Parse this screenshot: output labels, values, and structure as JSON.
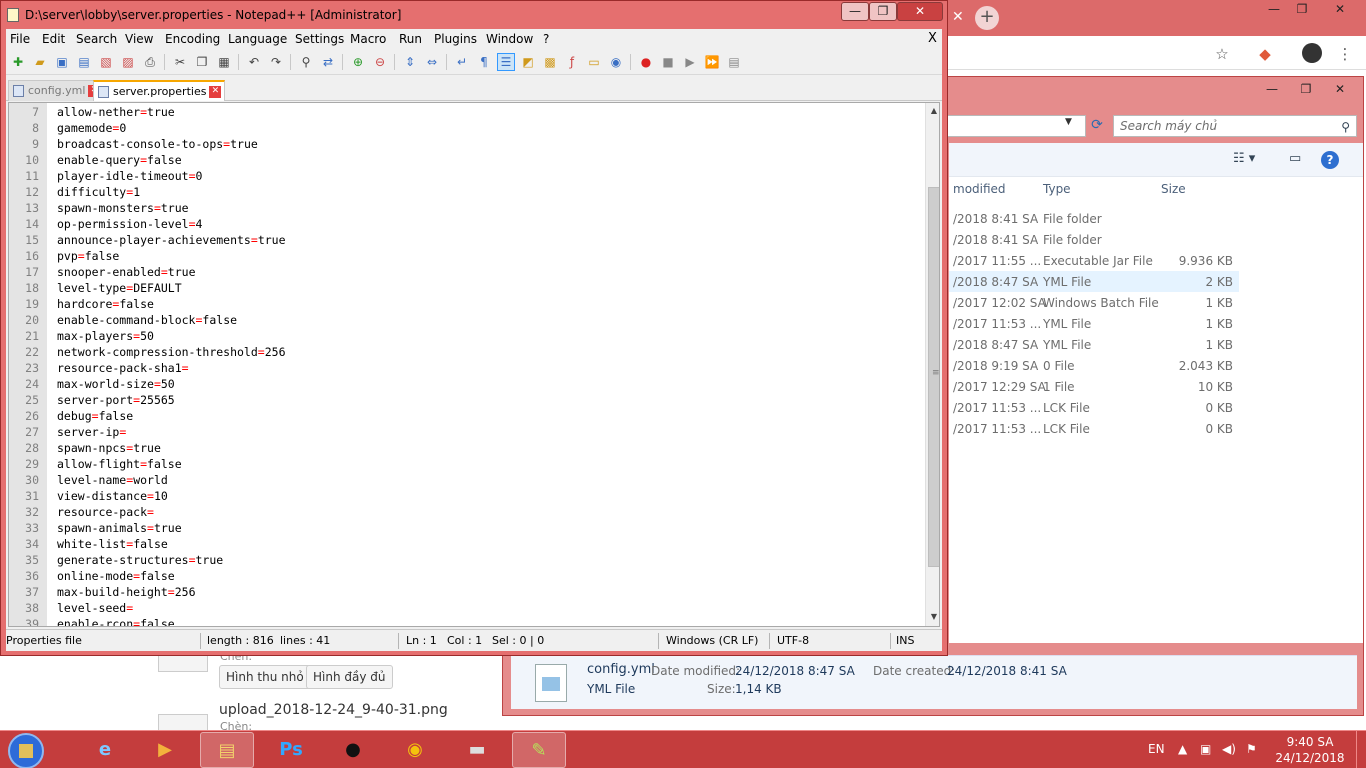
{
  "notepad": {
    "title": "D:\\server\\lobby\\server.properties - Notepad++ [Administrator]",
    "menu": [
      "File",
      "Edit",
      "Search",
      "View",
      "Encoding",
      "Language",
      "Settings",
      "Macro",
      "Run",
      "Plugins",
      "Window",
      "?"
    ],
    "menu_close": "X",
    "tabs": [
      {
        "label": "config.yml",
        "active": false
      },
      {
        "label": "server.properties",
        "active": true
      }
    ],
    "lines": [
      {
        "n": "7",
        "key": "allow-nether",
        "value": "true"
      },
      {
        "n": "8",
        "key": "gamemode",
        "value": "0"
      },
      {
        "n": "9",
        "key": "broadcast-console-to-ops",
        "value": "true"
      },
      {
        "n": "10",
        "key": "enable-query",
        "value": "false"
      },
      {
        "n": "11",
        "key": "player-idle-timeout",
        "value": "0"
      },
      {
        "n": "12",
        "key": "difficulty",
        "value": "1"
      },
      {
        "n": "13",
        "key": "spawn-monsters",
        "value": "true"
      },
      {
        "n": "14",
        "key": "op-permission-level",
        "value": "4"
      },
      {
        "n": "15",
        "key": "announce-player-achievements",
        "value": "true"
      },
      {
        "n": "16",
        "key": "pvp",
        "value": "false"
      },
      {
        "n": "17",
        "key": "snooper-enabled",
        "value": "true"
      },
      {
        "n": "18",
        "key": "level-type",
        "value": "DEFAULT"
      },
      {
        "n": "19",
        "key": "hardcore",
        "value": "false"
      },
      {
        "n": "20",
        "key": "enable-command-block",
        "value": "false"
      },
      {
        "n": "21",
        "key": "max-players",
        "value": "50"
      },
      {
        "n": "22",
        "key": "network-compression-threshold",
        "value": "256"
      },
      {
        "n": "23",
        "key": "resource-pack-sha1",
        "value": ""
      },
      {
        "n": "24",
        "key": "max-world-size",
        "value": "50"
      },
      {
        "n": "25",
        "key": "server-port",
        "value": "25565"
      },
      {
        "n": "26",
        "key": "debug",
        "value": "false"
      },
      {
        "n": "27",
        "key": "server-ip",
        "value": ""
      },
      {
        "n": "28",
        "key": "spawn-npcs",
        "value": "true"
      },
      {
        "n": "29",
        "key": "allow-flight",
        "value": "false"
      },
      {
        "n": "30",
        "key": "level-name",
        "value": "world"
      },
      {
        "n": "31",
        "key": "view-distance",
        "value": "10"
      },
      {
        "n": "32",
        "key": "resource-pack",
        "value": ""
      },
      {
        "n": "33",
        "key": "spawn-animals",
        "value": "true"
      },
      {
        "n": "34",
        "key": "white-list",
        "value": "false"
      },
      {
        "n": "35",
        "key": "generate-structures",
        "value": "true"
      },
      {
        "n": "36",
        "key": "online-mode",
        "value": "false"
      },
      {
        "n": "37",
        "key": "max-build-height",
        "value": "256"
      },
      {
        "n": "38",
        "key": "level-seed",
        "value": ""
      },
      {
        "n": "39",
        "key": "enable-rcon",
        "value": "false"
      }
    ],
    "status": {
      "file_type": "Properties file",
      "length": "length : 816",
      "lines": "lines : 41",
      "ln": "Ln : 1",
      "col": "Col : 1",
      "sel": "Sel : 0 | 0",
      "eol": "Windows (CR LF)",
      "encoding": "UTF-8",
      "mode": "INS"
    }
  },
  "explorer": {
    "search_placeholder": "Search máy chủ",
    "columns": {
      "modified": "modified",
      "type": "Type",
      "size": "Size"
    },
    "rows": [
      {
        "date": "/2018 8:41 SA",
        "type": "File folder",
        "size": ""
      },
      {
        "date": "/2018 8:41 SA",
        "type": "File folder",
        "size": ""
      },
      {
        "date": "/2017 11:55 ...",
        "type": "Executable Jar File",
        "size": "9.936 KB"
      },
      {
        "date": "/2018 8:47 SA",
        "type": "YML File",
        "size": "2 KB",
        "selected": true
      },
      {
        "date": "/2017 12:02 SA",
        "type": "Windows Batch File",
        "size": "1 KB"
      },
      {
        "date": "/2017 11:53 ...",
        "type": "YML File",
        "size": "1 KB"
      },
      {
        "date": "/2018 8:47 SA",
        "type": "YML File",
        "size": "1 KB"
      },
      {
        "date": "/2018 9:19 SA",
        "type": "0 File",
        "size": "2.043 KB"
      },
      {
        "date": "/2017 12:29 SA",
        "type": "1 File",
        "size": "10 KB"
      },
      {
        "date": "/2017 11:53 ...",
        "type": "LCK File",
        "size": "0 KB"
      },
      {
        "date": "/2017 11:53 ...",
        "type": "LCK File",
        "size": "0 KB"
      }
    ],
    "details": {
      "name": "config.yml",
      "kind": "YML File",
      "modified_label": "Date modified:",
      "modified": "24/12/2018 8:47 SA",
      "created_label": "Date created:",
      "created": "24/12/2018 8:41 SA",
      "size_label": "Size:",
      "size": "1,14 KB"
    }
  },
  "browser_page": {
    "btn_thumb": "Hình thu nhỏ",
    "btn_full": "Hình đầy đủ",
    "upload_name": "upload_2018-12-24_9-40-31.png",
    "insert_label": "Chèn:",
    "insert_label_top": "Chèn:"
  },
  "taskbar": {
    "lang": "EN",
    "time": "9:40 SA",
    "date": "24/12/2018"
  },
  "colors": {
    "window_frame": "#e56f6f",
    "taskbar": "#c43d3d",
    "eq_sign": "#ff0000"
  }
}
